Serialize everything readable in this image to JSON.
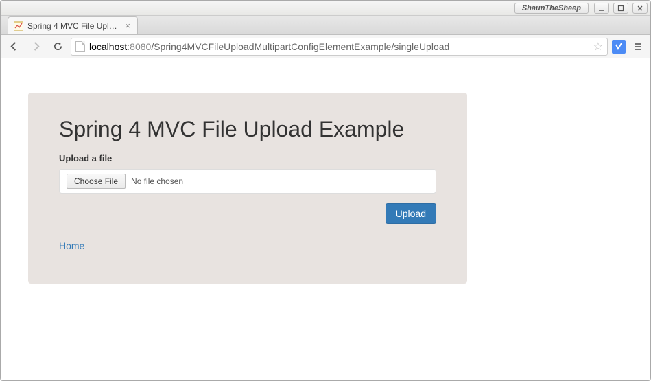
{
  "window": {
    "user_label": "ShaunTheSheep"
  },
  "browser": {
    "tab_title": "Spring 4 MVC File Upload",
    "url_host_strong": "localhost",
    "url_host_dim": ":8080",
    "url_path": "/Spring4MVCFileUploadMultipartConfigElementExample/singleUpload"
  },
  "page": {
    "heading": "Spring 4 MVC File Upload Example",
    "form_label": "Upload a file",
    "choose_file_label": "Choose File",
    "no_file_text": "No file chosen",
    "upload_button": "Upload",
    "home_link": "Home"
  }
}
